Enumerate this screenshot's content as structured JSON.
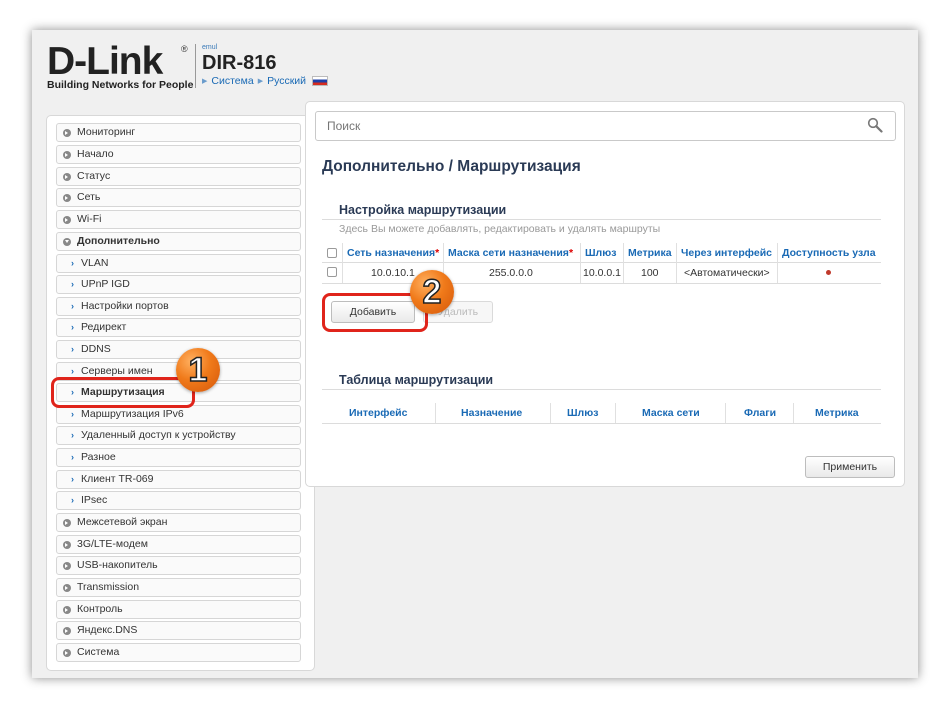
{
  "header": {
    "brand": "D-Link",
    "tagline": "Building Networks for People",
    "model_sub": "emul",
    "model": "DIR-816",
    "crumbs": [
      "Система",
      "Русский"
    ]
  },
  "search": {
    "placeholder": "Поиск",
    "icon": "search-icon"
  },
  "page_title": "Дополнительно /  Маршрутизация",
  "sidebar": {
    "items": [
      {
        "label": "Мониторинг"
      },
      {
        "label": "Начало"
      },
      {
        "label": "Статус"
      },
      {
        "label": "Сеть"
      },
      {
        "label": "Wi-Fi"
      },
      {
        "label": "Дополнительно"
      },
      {
        "label": "VLAN"
      },
      {
        "label": "UPnP IGD"
      },
      {
        "label": "Настройки портов"
      },
      {
        "label": "Редирект"
      },
      {
        "label": "DDNS"
      },
      {
        "label": "Серверы имен"
      },
      {
        "label": "Маршрутизация"
      },
      {
        "label": "Маршрутизация IPv6"
      },
      {
        "label": "Удаленный доступ к устройству"
      },
      {
        "label": "Разное"
      },
      {
        "label": "Клиент TR-069"
      },
      {
        "label": "IPsec"
      },
      {
        "label": "Межсетевой экран"
      },
      {
        "label": "3G/LTE-модем"
      },
      {
        "label": "USB-накопитель"
      },
      {
        "label": "Transmission"
      },
      {
        "label": "Контроль"
      },
      {
        "label": "Яндекс.DNS"
      },
      {
        "label": "Система"
      }
    ]
  },
  "routing_setup": {
    "title": "Настройка маршрутизации",
    "description": "Здесь Вы можете добавлять, редактировать и удалять маршруты",
    "columns": [
      "Сеть назначения",
      "Маска сети назначения",
      "Шлюз",
      "Метрика",
      "Через интерфейс",
      "Доступность узла"
    ],
    "required_mark": "*",
    "rows": [
      {
        "network": "10.0.10.1",
        "mask": "255.0.0.0",
        "gateway": "10.0.0.1",
        "metric": "100",
        "interface": "<Автоматически>"
      }
    ],
    "add_label": "Добавить",
    "delete_label": "Удалить"
  },
  "routing_table": {
    "title": "Таблица маршрутизации",
    "columns": [
      "Интерфейс",
      "Назначение",
      "Шлюз",
      "Маска сети",
      "Флаги",
      "Метрика"
    ]
  },
  "apply_label": "Применить",
  "callouts": [
    "1",
    "2"
  ],
  "colors": {
    "accent": "#1a6ab5",
    "highlight": "#e0241b",
    "badge": "#f07a1a"
  }
}
